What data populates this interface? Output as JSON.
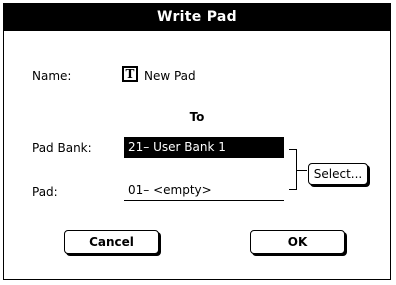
{
  "dialog": {
    "title": "Write Pad",
    "name_label": "Name:",
    "name_icon": "T",
    "name_value": "New Pad",
    "to_label": "To",
    "pad_bank_label": "Pad Bank:",
    "pad_bank_value": "21– User Bank 1",
    "pad_label": "Pad:",
    "pad_value": "01– <empty>",
    "select_button": "Select...",
    "cancel_button": "Cancel",
    "ok_button": "OK"
  }
}
